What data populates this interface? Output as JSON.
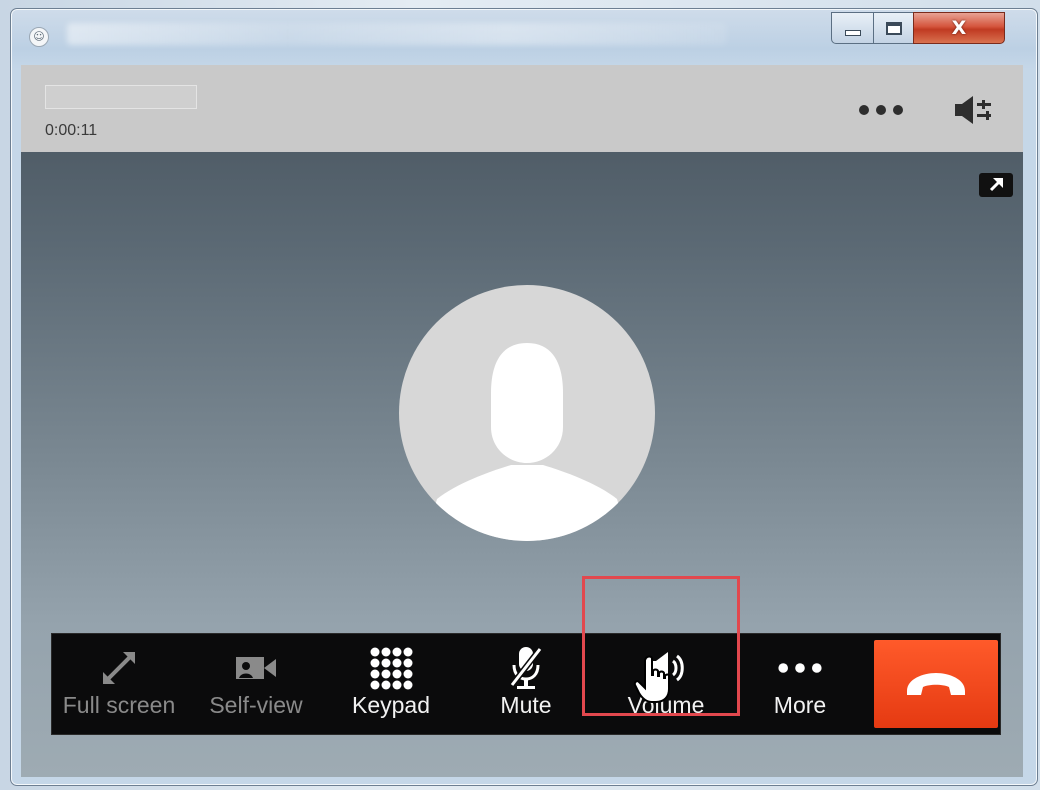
{
  "window": {
    "controls": {
      "minimize_icon": "minimize-icon",
      "maximize_icon": "maximize-icon",
      "close_label": "X"
    }
  },
  "call": {
    "duration": "0:00:11",
    "header_more_icon": "more-dots-icon",
    "audio_icon": "speaker-settings-icon",
    "popout_icon": "popout-arrow-icon"
  },
  "toolbar": {
    "buttons": [
      {
        "label": "Full screen",
        "icon": "expand-icon",
        "enabled": false
      },
      {
        "label": "Self-view",
        "icon": "video-camera-icon",
        "enabled": false
      },
      {
        "label": "Keypad",
        "icon": "keypad-icon",
        "enabled": true
      },
      {
        "label": "Mute",
        "icon": "mic-off-icon",
        "enabled": true
      },
      {
        "label": "Volume",
        "icon": "speaker-icon",
        "enabled": true
      },
      {
        "label": "More",
        "icon": "more-dots-icon",
        "enabled": true
      }
    ],
    "end_call_icon": "hang-up-phone-icon"
  },
  "colors": {
    "end_call": "#f0461b",
    "highlight": "#e2484e",
    "toolbar_bg": "#0b0b0c"
  }
}
